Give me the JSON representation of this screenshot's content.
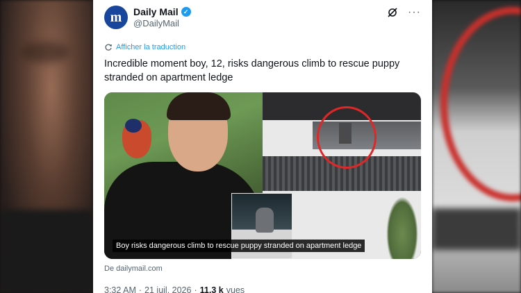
{
  "tweet": {
    "author_name": "Daily Mail",
    "author_handle": "@DailyMail",
    "avatar_letter": "m",
    "translate_label": "Afficher la traduction",
    "text": "Incredible moment boy, 12, risks dangerous climb to rescue puppy stranded on apartment ledge",
    "media_caption": "Boy risks dangerous climb to rescue puppy stranded on apartment ledge",
    "source_label": "De dailymail.com",
    "time": "3:32 AM",
    "separator": "·",
    "date": "21 juil. 2026",
    "views_count": "11,3 k",
    "views_label": "vues"
  },
  "icons": {
    "verified": "verified-badge-icon",
    "grok": "grok-icon",
    "more": "more-options-icon",
    "translate": "translate-icon"
  },
  "colors": {
    "accent": "#1d9bf0",
    "brand": "#18469d",
    "text_primary": "#0f1419",
    "text_secondary": "#536471",
    "highlight_ring": "#e02727"
  }
}
